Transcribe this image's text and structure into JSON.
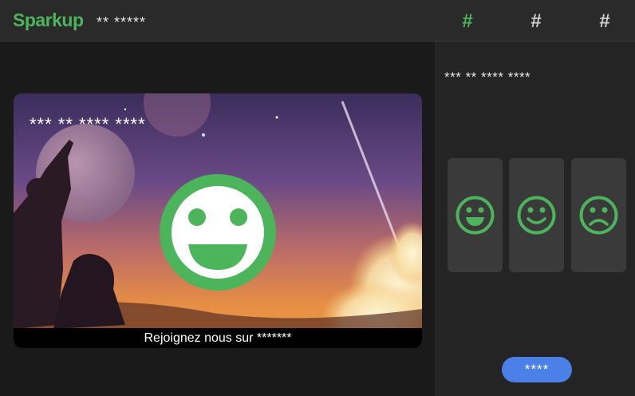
{
  "header": {
    "logo": "Sparkup",
    "subtitle": "** *****",
    "nav": [
      {
        "label": "#",
        "active": true
      },
      {
        "label": "#",
        "active": false
      },
      {
        "label": "#",
        "active": false
      }
    ]
  },
  "card": {
    "title": "*** ** **** ****",
    "footer": "Rejoignez nous sur *******",
    "smiley": "happy-face-icon"
  },
  "sidebar": {
    "title": "*** ** **** ****",
    "moods": [
      {
        "icon": "grin-face-icon"
      },
      {
        "icon": "smile-face-icon"
      },
      {
        "icon": "sad-face-icon"
      }
    ],
    "submit_label": "****"
  },
  "colors": {
    "accent_green": "#4cb45a",
    "button_blue": "#4a80e8",
    "topbar": "#2a2a2a",
    "panel": "#242424",
    "mood_tile": "#3a3a3a"
  }
}
